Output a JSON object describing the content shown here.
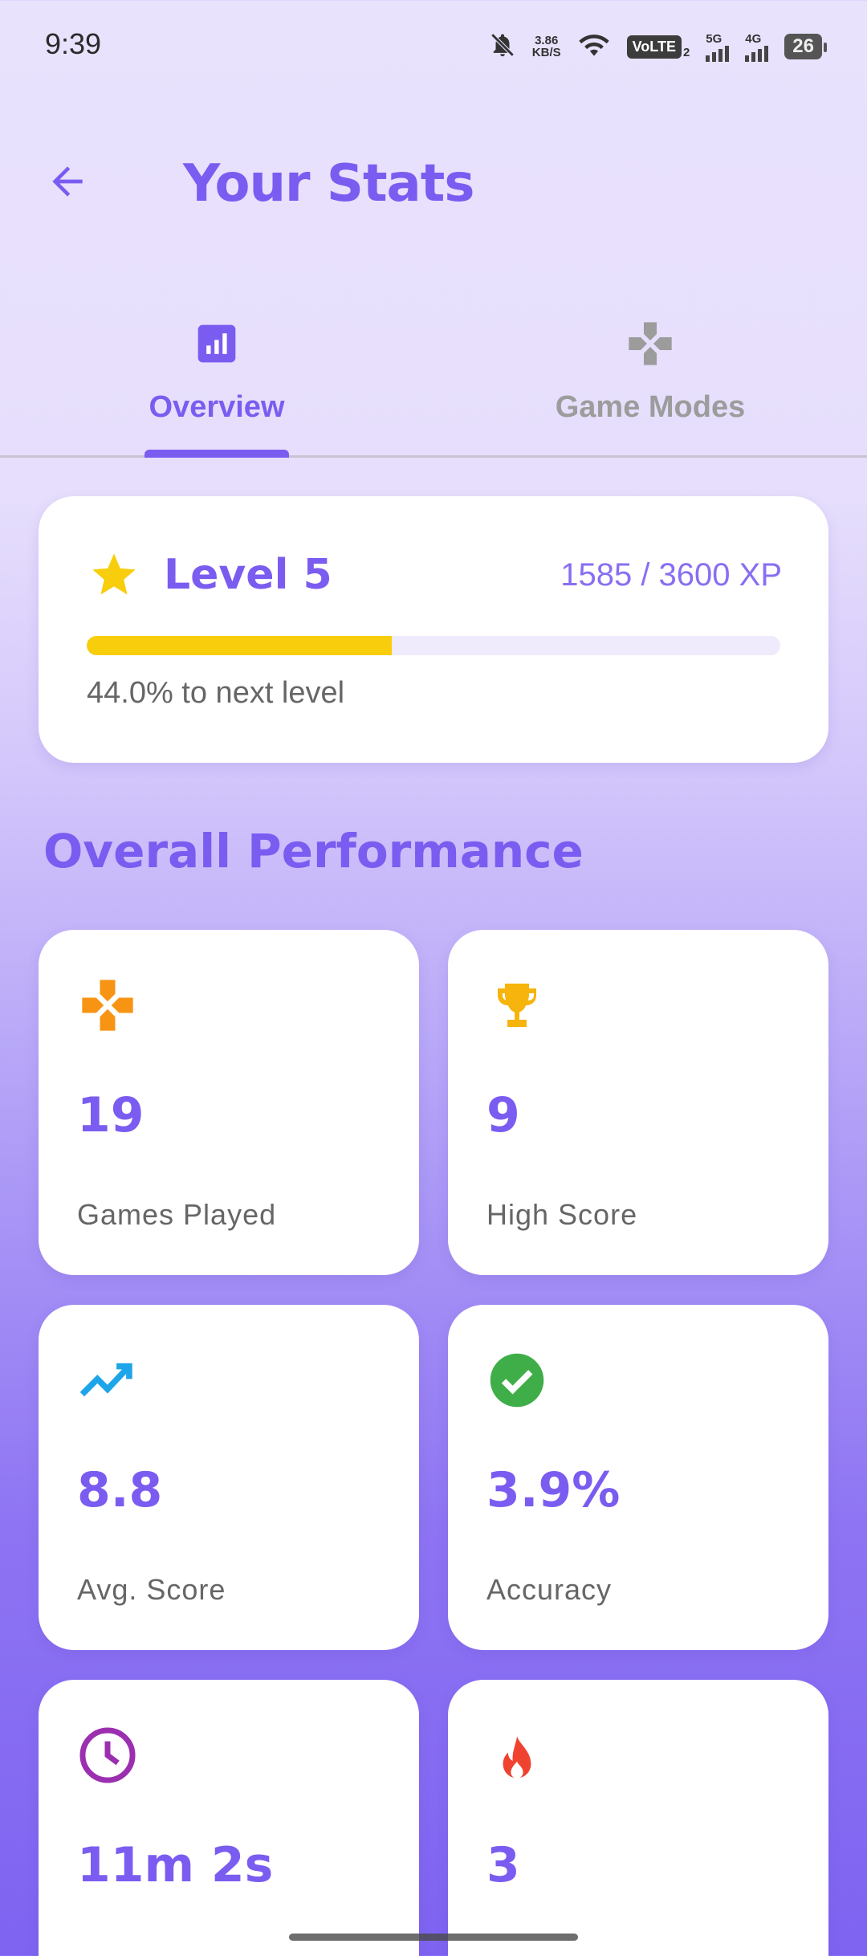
{
  "status_bar": {
    "time": "9:39",
    "net_speed_value": "3.86",
    "net_speed_unit": "KB/S",
    "volte": "VoLTE",
    "volte_sim": "2",
    "signal1": "5G",
    "signal2": "4G",
    "battery": "26"
  },
  "header": {
    "back_icon": "arrow-left-icon",
    "title": "Your Stats"
  },
  "tabs": [
    {
      "label": "Overview",
      "icon": "bar-chart-icon",
      "selected": true
    },
    {
      "label": "Game Modes",
      "icon": "gamepad-icon",
      "selected": false
    }
  ],
  "level_card": {
    "level": "Level 5",
    "xp": "1585 / 3600 XP",
    "progress": 0.44,
    "progress_text": "44.0% to next level",
    "star_color": "#f8ce0c"
  },
  "section_title": "Overall Performance",
  "stats": [
    {
      "value": "19",
      "label": "Games Played",
      "icon": "gamepad-icon",
      "color": "#f89414"
    },
    {
      "value": "9",
      "label": "High Score",
      "icon": "trophy-icon",
      "color": "#f6b40c"
    },
    {
      "value": "8.8",
      "label": "Avg. Score",
      "icon": "trending-up-icon",
      "color": "#1ea5e9"
    },
    {
      "value": "3.9%",
      "label": "Accuracy",
      "icon": "check-circle-icon",
      "color": "#3fae49"
    },
    {
      "value": "11m 2s",
      "label": "",
      "icon": "clock-icon",
      "color": "#9b2fb0"
    },
    {
      "value": "3",
      "label": "",
      "icon": "fire-icon",
      "color": "#ef4330"
    }
  ],
  "colors": {
    "accent": "#7b5cf0",
    "progress_fill": "#f8ce0c",
    "progress_track": "#efeafc"
  }
}
